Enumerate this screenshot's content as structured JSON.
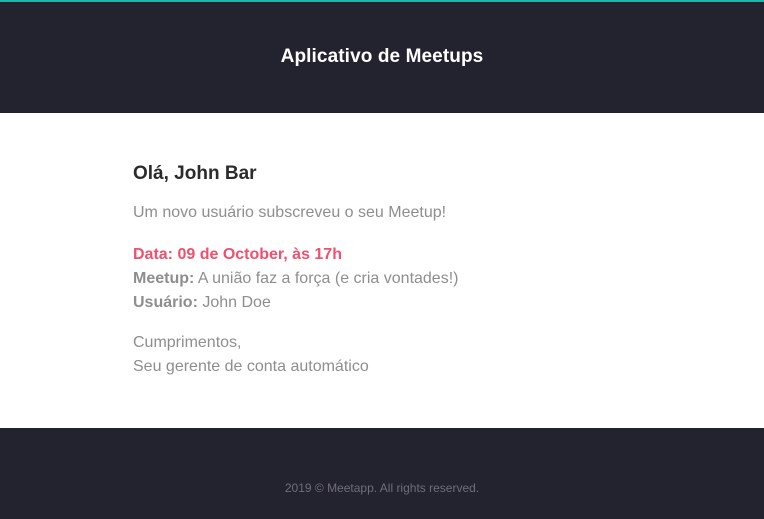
{
  "header": {
    "title": "Aplicativo de Meetups",
    "accent_color": "#1fb5a8",
    "background_color": "#23222f"
  },
  "email": {
    "greeting": "Olá, John Bar",
    "intro": "Um novo usuário subscreveu o seu Meetup!",
    "date_line": "Data: 09 de October, às 17h",
    "meetup_label": "Meetup:",
    "meetup_value": "A união faz a força (e cria vontades!)",
    "user_label": "Usuário:",
    "user_value": "John Doe",
    "closing_line1": "Cumprimentos,",
    "closing_line2": "Seu gerente de conta automático",
    "highlight_color": "#f0506e"
  },
  "footer": {
    "copyright": "2019 © Meetapp. All rights reserved."
  }
}
